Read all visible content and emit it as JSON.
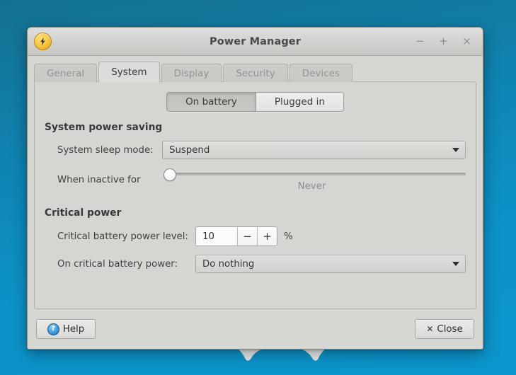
{
  "window": {
    "title": "Power Manager",
    "app_icon": "lightning-bolt-icon",
    "controls": {
      "minimize": "−",
      "maximize": "+",
      "close": "×"
    }
  },
  "tabs": [
    {
      "label": "General",
      "active": false
    },
    {
      "label": "System",
      "active": true
    },
    {
      "label": "Display",
      "active": false
    },
    {
      "label": "Security",
      "active": false
    },
    {
      "label": "Devices",
      "active": false
    }
  ],
  "power_source_toggle": {
    "options": [
      {
        "label": "On battery",
        "selected": true
      },
      {
        "label": "Plugged in",
        "selected": false
      }
    ]
  },
  "sections": {
    "system_power_saving": {
      "title": "System power saving",
      "sleep_mode": {
        "label": "System sleep mode:",
        "value": "Suspend"
      },
      "inactive": {
        "label": "When inactive for",
        "value_caption": "Never",
        "position_percent": 0
      }
    },
    "critical_power": {
      "title": "Critical power",
      "battery_level": {
        "label": "Critical battery power level:",
        "value": "10",
        "decrement": "−",
        "increment": "+",
        "unit": "%"
      },
      "on_critical": {
        "label": "On critical battery power:",
        "value": "Do nothing"
      }
    }
  },
  "actions": {
    "help": {
      "label": "Help",
      "icon": "help-circle-icon"
    },
    "close": {
      "label": "Close",
      "icon": "close-x-icon"
    }
  },
  "theme": {
    "desktop_top": "#14708f",
    "desktop_bottom": "#0c96cd",
    "window_bg": "#d6d6d3",
    "accent_icon": "#f5c33e"
  }
}
